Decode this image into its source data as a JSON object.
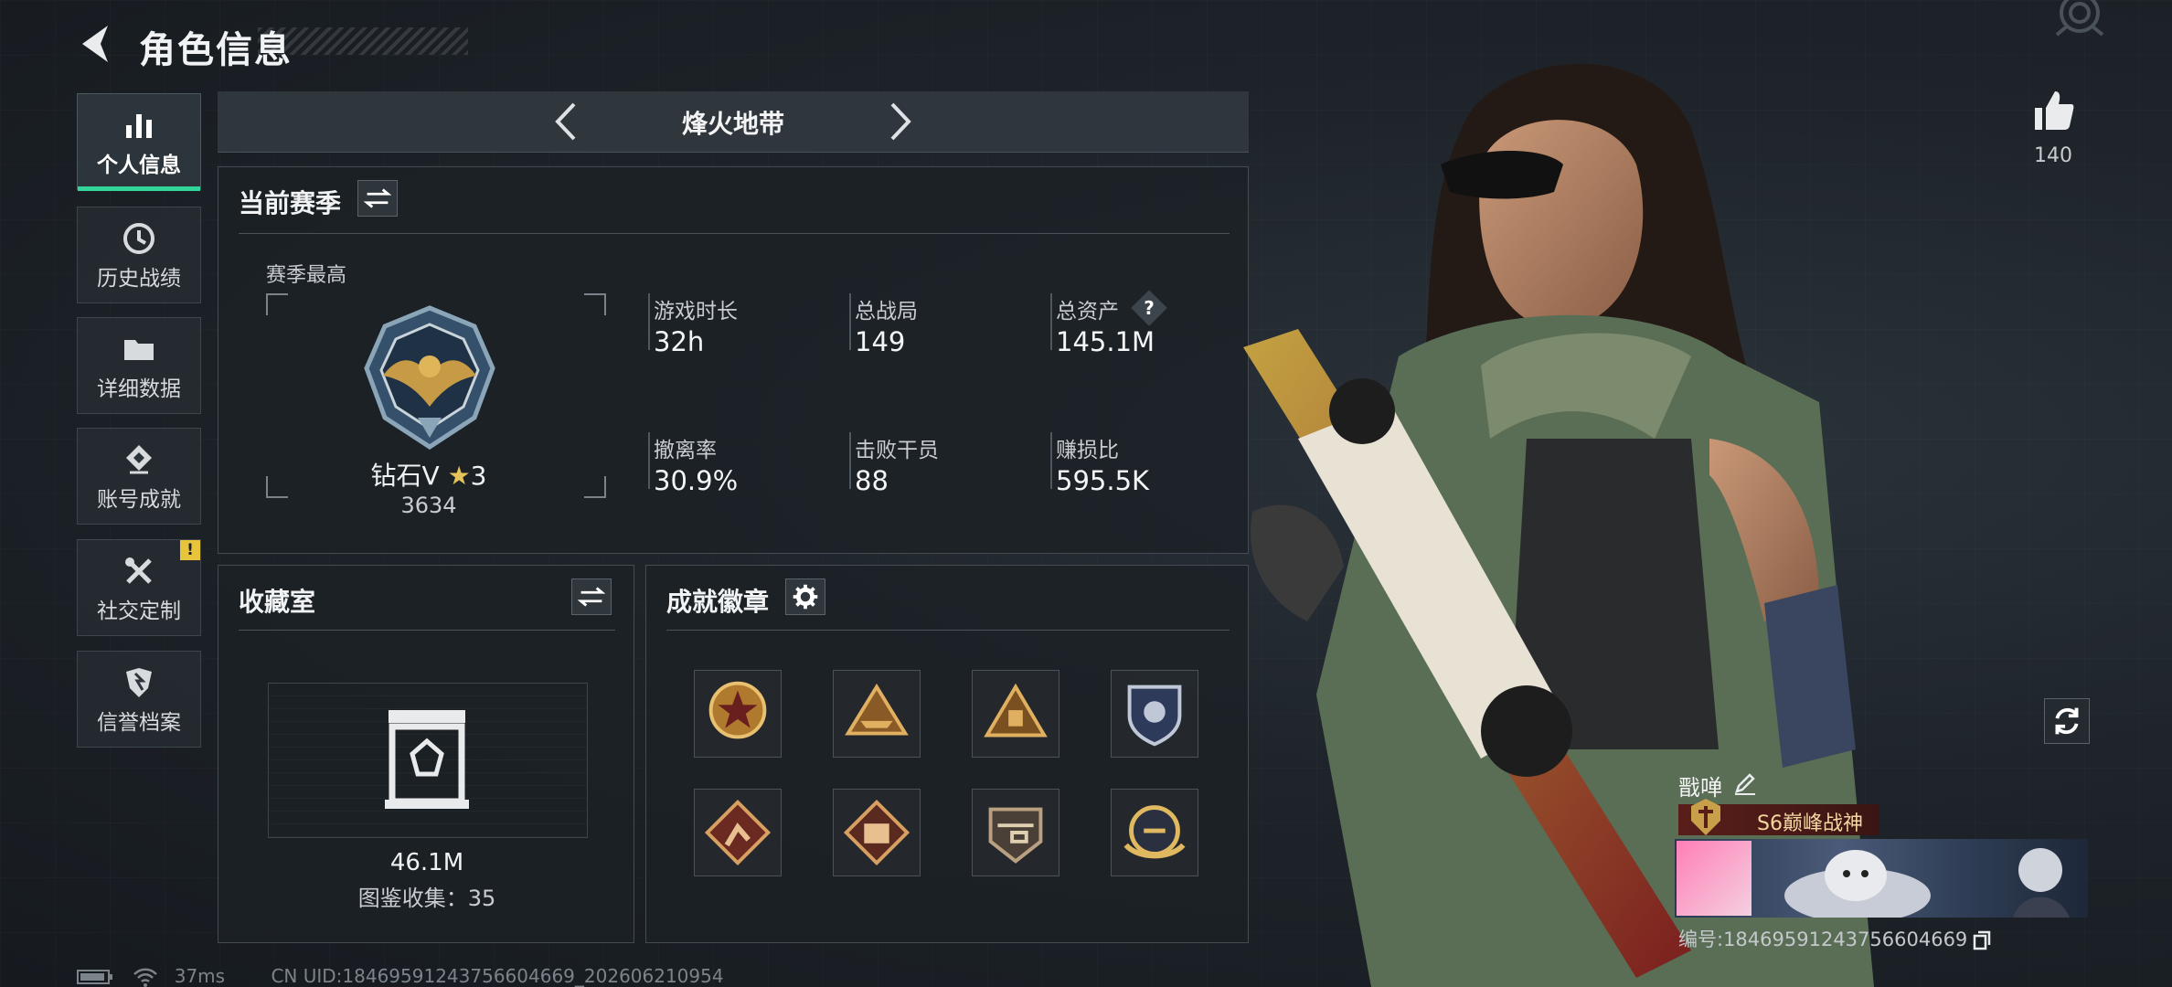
{
  "header": {
    "title": "角色信息"
  },
  "sidebar": [
    {
      "label": "个人信息",
      "icon": "bar-chart-icon",
      "active": true
    },
    {
      "label": "历史战绩",
      "icon": "history-icon"
    },
    {
      "label": "详细数据",
      "icon": "folder-icon"
    },
    {
      "label": "账号成就",
      "icon": "achievement-icon"
    },
    {
      "label": "社交定制",
      "icon": "tools-icon",
      "alert": "!"
    },
    {
      "label": "信誉档案",
      "icon": "shield-icon"
    }
  ],
  "mode": {
    "name": "烽火地带"
  },
  "season": {
    "title": "当前赛季",
    "best_label": "赛季最高",
    "rank_name": "钻石V",
    "rank_stars": "3",
    "rank_score": "3634",
    "stats": [
      {
        "label": "游戏时长",
        "value": "32h"
      },
      {
        "label": "总战局",
        "value": "149"
      },
      {
        "label": "总资产",
        "value": "145.1M",
        "help": "?"
      },
      {
        "label": "撤离率",
        "value": "30.9%"
      },
      {
        "label": "击败干员",
        "value": "88"
      },
      {
        "label": "赚损比",
        "value": "595.5K"
      }
    ]
  },
  "collection": {
    "title": "收藏室",
    "value": "46.1M",
    "count_text": "图鉴收集：35"
  },
  "badges": {
    "title": "成就徽章",
    "items": [
      "star-medal-icon",
      "ship-badge-icon",
      "pyramid-badge-icon",
      "shield-emblem-icon",
      "runner-badge-icon",
      "fist-badge-icon",
      "helicopter-badge-icon",
      "wings-emblem-icon"
    ]
  },
  "profile": {
    "likes": "140",
    "name": "戬啴",
    "tag": "S6巅峰战神",
    "uid_text": "编号:1846959124375660466​9"
  },
  "status": {
    "ping": "37ms",
    "uid_line": "CN UID:18469591243756604669_202606210954"
  },
  "colors": {
    "accent": "#33d69a",
    "warning": "#e8c33c",
    "tag": "#5a1e1a"
  }
}
